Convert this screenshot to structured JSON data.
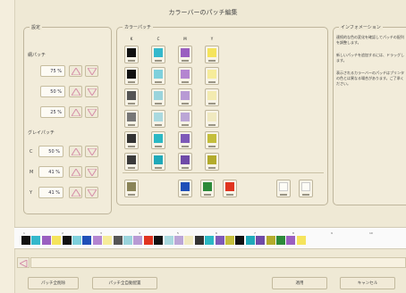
{
  "title": "カラーバーのパッチ編集",
  "left_group": {
    "label": "設定",
    "tone_label": "網パッチ",
    "tone_values": [
      "75 %",
      "50 %",
      "25 %"
    ],
    "gray_label": "グレイパッチ",
    "gray_rows": [
      {
        "prefix": "C",
        "value": "50 %"
      },
      {
        "prefix": "M",
        "value": "41 %"
      },
      {
        "prefix": "Y",
        "value": "41 %"
      }
    ]
  },
  "palette": {
    "label": "カラーパッチ",
    "columns": [
      "K",
      "C",
      "M",
      "Y"
    ],
    "rows": [
      [
        "#111111",
        "#34b8cc",
        "#9a5fc0",
        "#f5e45c"
      ],
      [
        "#111111",
        "#7ed0dc",
        "#b485d0",
        "#f6ec9a"
      ],
      [
        "#555555",
        "#9ad4dc",
        "#b89ad4",
        "#f3ebb0"
      ],
      [
        "#777777",
        "#a9d9df",
        "#bba6d6",
        "#f0e9c0"
      ],
      [
        "#333333",
        "#2bb8c4",
        "#7e59b8",
        "#c4be3c"
      ],
      [
        "#3a3a3a",
        "#1fa9b9",
        "#6f4aa8",
        "#b3ab2c"
      ]
    ],
    "bottom_row": [
      "#8a8458",
      "#1f4fb8",
      "#2c8a3a",
      "#e0341f",
      "#fdfcf6",
      "#fdfcf6"
    ]
  },
  "info": {
    "label": "インフォメーション",
    "paragraphs": [
      "連続的な色の変化を確認してパッチの配列を調整します。",
      "新しいパッチを追加するには、ドラッグします。",
      "表示されるカラーバーのパッチはプリンタの色とは異なる場合があります。ご了承ください。"
    ]
  },
  "strip": {
    "top_labels": [
      "1",
      "2",
      "3",
      "4",
      "5",
      "6",
      "7",
      "8",
      "9",
      "10"
    ],
    "colors": [
      "#111111",
      "#34b8cc",
      "#9a5fc0",
      "#f5e45c",
      "#111111",
      "#7ed0dc",
      "#1f4fb8",
      "#b485d0",
      "#f6ec9a",
      "#555555",
      "#9ad4dc",
      "#b89ad4",
      "#e0341f",
      "#111111",
      "#a9d9df",
      "#bba6d6",
      "#f0e9c0",
      "#333333",
      "#2bb8c4",
      "#7e59b8",
      "#c4be3c",
      "#111111",
      "#1fa9b9",
      "#6f4aa8",
      "#b3ab2c",
      "#2c8a3a",
      "#9a5fc0",
      "#f5e45c"
    ]
  },
  "buttons": {
    "left1": "パッチ全削除",
    "left2": "パッチ全自動配置",
    "ok": "適用",
    "cancel": "キャンセル"
  }
}
